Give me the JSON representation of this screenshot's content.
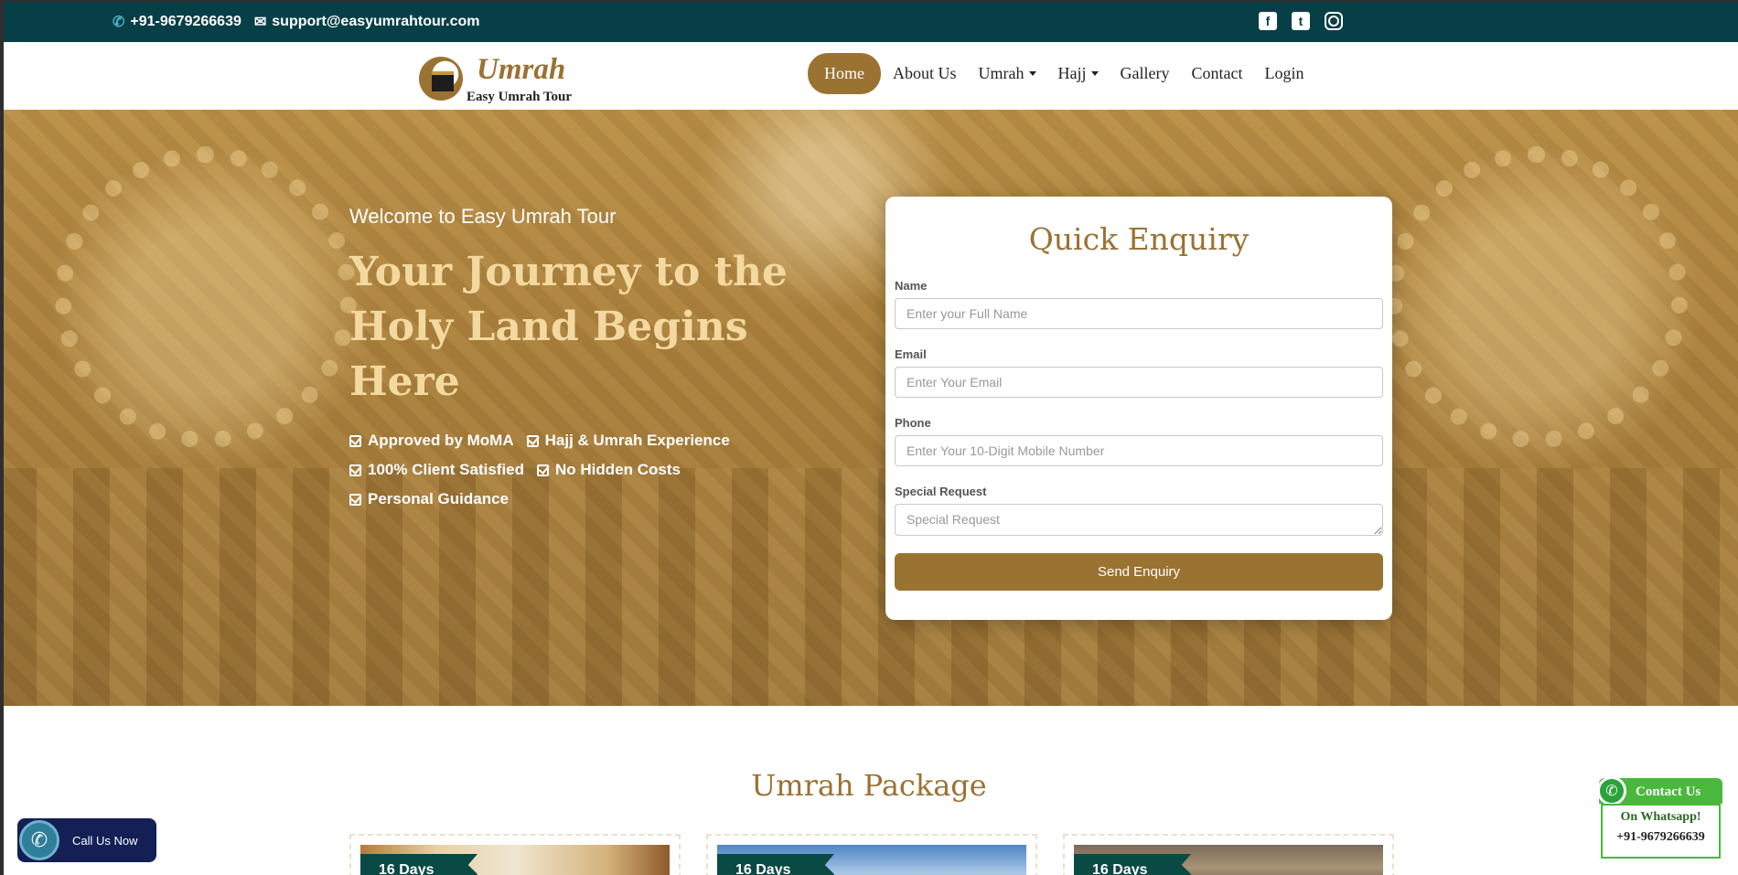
{
  "topbar": {
    "phone": "+91-9679266639",
    "email": "support@easyumrahtour.com",
    "social": [
      "facebook-icon",
      "twitter-icon",
      "instagram-icon"
    ]
  },
  "logo": {
    "title": "Umrah",
    "subtitle": "Easy Umrah Tour"
  },
  "nav": {
    "items": [
      {
        "label": "Home",
        "active": true
      },
      {
        "label": "About Us"
      },
      {
        "label": "Umrah",
        "dropdown": true
      },
      {
        "label": "Hajj",
        "dropdown": true
      },
      {
        "label": "Gallery"
      },
      {
        "label": "Contact"
      },
      {
        "label": "Login"
      }
    ]
  },
  "hero": {
    "welcome": "Welcome to Easy Umrah Tour",
    "headline_line1": "Your Journey to the",
    "headline_line2": "Holy Land Begins Here",
    "features": [
      "Approved by MoMA",
      "Hajj & Umrah Experience",
      "100% Client Satisfied",
      "No Hidden Costs",
      "Personal Guidance"
    ]
  },
  "enquiry": {
    "title": "Quick Enquiry",
    "name_label": "Name",
    "name_placeholder": "Enter your Full Name",
    "email_label": "Email",
    "email_placeholder": "Enter Your Email",
    "phone_label": "Phone",
    "phone_placeholder": "Enter Your 10-Digit Mobile Number",
    "request_label": "Special Request",
    "request_placeholder": "Special Request",
    "submit_label": "Send Enquiry"
  },
  "packages": {
    "title": "Umrah Package",
    "cards": [
      {
        "badge": "16 Days"
      },
      {
        "badge": "16 Days"
      },
      {
        "badge": "16 Days"
      }
    ]
  },
  "call_widget": {
    "label": "Call Us Now"
  },
  "whatsapp_widget": {
    "title": "Contact Us",
    "line1": "On Whatsapp!",
    "phone": "+91-9679266639"
  },
  "colors": {
    "topbar": "#073f47",
    "accent_gold": "#9a7232",
    "badge_green": "#0a4a44",
    "whatsapp_green": "#49b83d",
    "call_navy": "#131f55"
  }
}
